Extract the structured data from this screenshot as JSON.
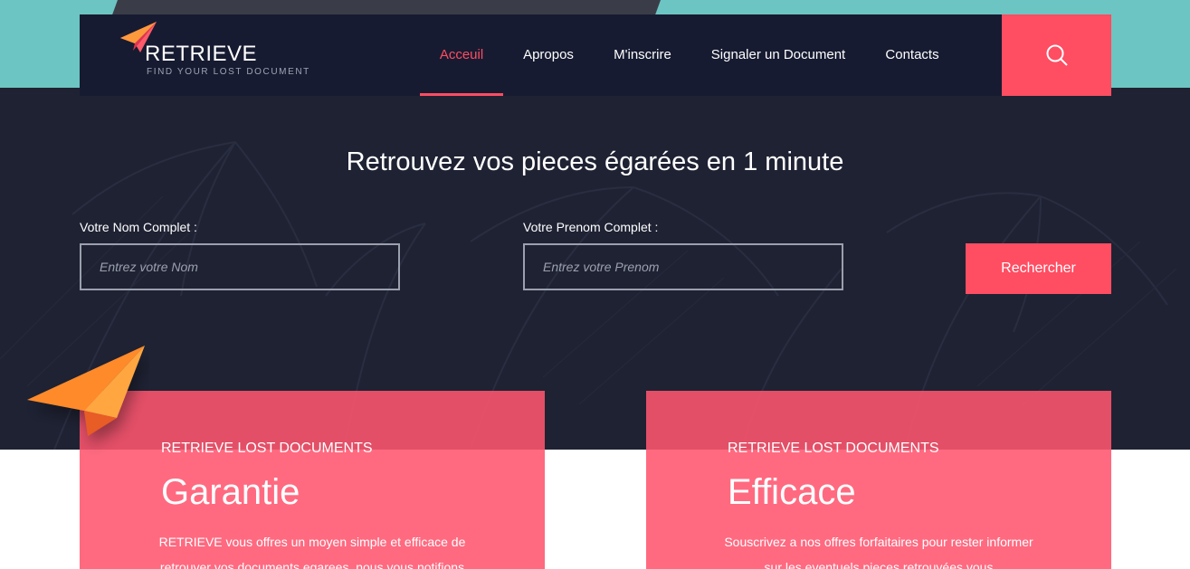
{
  "brand": {
    "name": "RETRIEVE",
    "tagline": "FIND YOUR LOST DOCUMENT"
  },
  "nav": {
    "items": [
      {
        "label": "Acceuil",
        "active": true
      },
      {
        "label": "Apropos",
        "active": false
      },
      {
        "label": "M'inscrire",
        "active": false
      },
      {
        "label": "Signaler un Document",
        "active": false
      },
      {
        "label": "Contacts",
        "active": false
      }
    ],
    "search_icon": "search-icon"
  },
  "hero": {
    "title": "Retrouvez vos pieces égarées en 1 minute"
  },
  "search_form": {
    "nom_label": "Votre Nom Complet :",
    "nom_placeholder": "Entrez votre Nom",
    "prenom_label": "Votre Prenom Complet :",
    "prenom_placeholder": "Entrez votre Prenom",
    "submit_label": "Rechercher"
  },
  "cards": [
    {
      "eyebrow": "RETRIEVE LOST DOCUMENTS",
      "title": "Garantie",
      "text": "RETRIEVE vous offres un moyen simple et efficace de retrouver vos documents egarees, nous vous notifions"
    },
    {
      "eyebrow": "RETRIEVE LOST DOCUMENTS",
      "title": "Efficace",
      "text": "Souscrivez a nos offres forfaitaires pour rester informer sur les eventuels pieces retrouvées vous"
    }
  ],
  "colors": {
    "accent": "#ff4d62",
    "navbar": "#171b31",
    "hero_bg": "#1f2233",
    "teal": "#6cc4c3"
  }
}
